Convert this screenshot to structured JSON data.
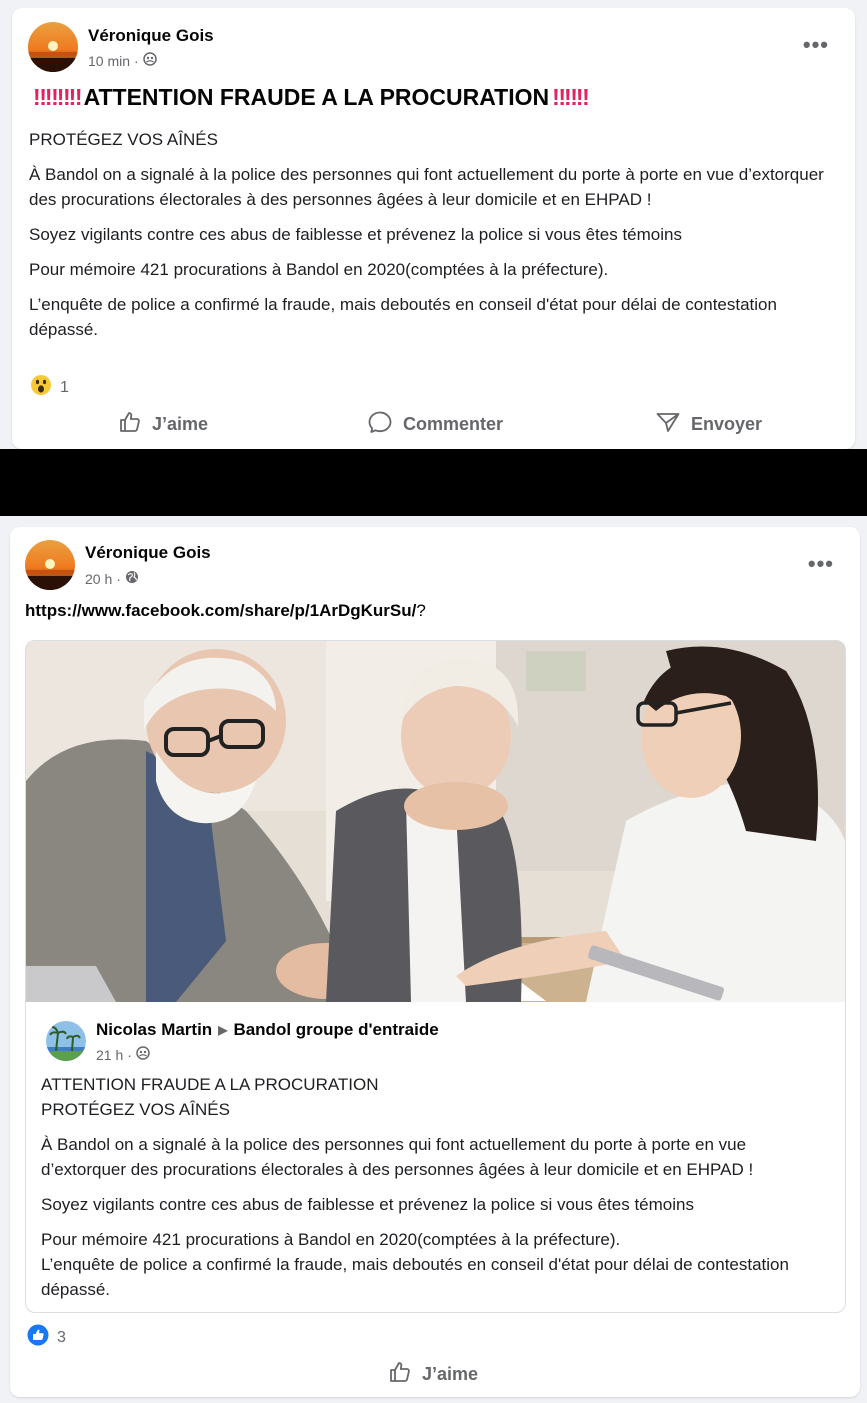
{
  "post1": {
    "author": "Véronique Gois",
    "time": "10 min",
    "headline": "ATTENTION FRAUDE A LA PROCURATION",
    "paragraphs": [
      "PROTÉGEZ VOS AÎNÉS",
      "À Bandol on a signalé à la police des personnes qui font actuellement du porte à porte en vue d’extorquer des procurations électorales à des personnes âgées à leur domicile et en EHPAD !",
      "Soyez vigilants contre ces abus de faiblesse et prévenez la police si vous êtes témoins",
      "Pour mémoire 421 procurations à Bandol en 2020(comptées à la préfecture).",
      "L’enquête de police a confirmé la fraude, mais deboutés en conseil d'état pour délai de contestation dépassé."
    ],
    "reaction_count": "1",
    "reaction_icon": "wow-emoji-icon",
    "actions": {
      "like": "J’aime",
      "comment": "Commenter",
      "send": "Envoyer"
    }
  },
  "post2": {
    "author": "Véronique Gois",
    "time": "20 h",
    "link_url": "https://www.facebook.com/share/p/1ArDgKurSu/",
    "link_suffix": "?",
    "shared": {
      "author": "Nicolas Martin",
      "group": "Bandol groupe d'entraide",
      "time": "21 h",
      "line1": "ATTENTION FRAUDE A LA PROCURATION",
      "line2": "PROTÉGEZ VOS AÎNÉS",
      "para1": "À Bandol on a signalé à la police des personnes qui font actuellement du porte à porte en vue d’extorquer des procurations électorales à des personnes âgées à leur domicile et en EHPAD !",
      "para2": "Soyez vigilants contre ces abus de faiblesse et prévenez la police si vous êtes témoins",
      "para3a": "Pour mémoire 421 procurations à Bandol en 2020(comptées à la préfecture).",
      "para3b": "L’enquête de police a confirmé la fraude, mais deboutés en conseil d'état pour délai de contestation dépassé."
    },
    "reaction_count": "3",
    "reaction_icon": "like-reaction-icon",
    "actions": {
      "like": "J’aime"
    }
  },
  "colors": {
    "accent": "#1877f2",
    "bang": "#e0245e",
    "muted": "#65676b"
  }
}
